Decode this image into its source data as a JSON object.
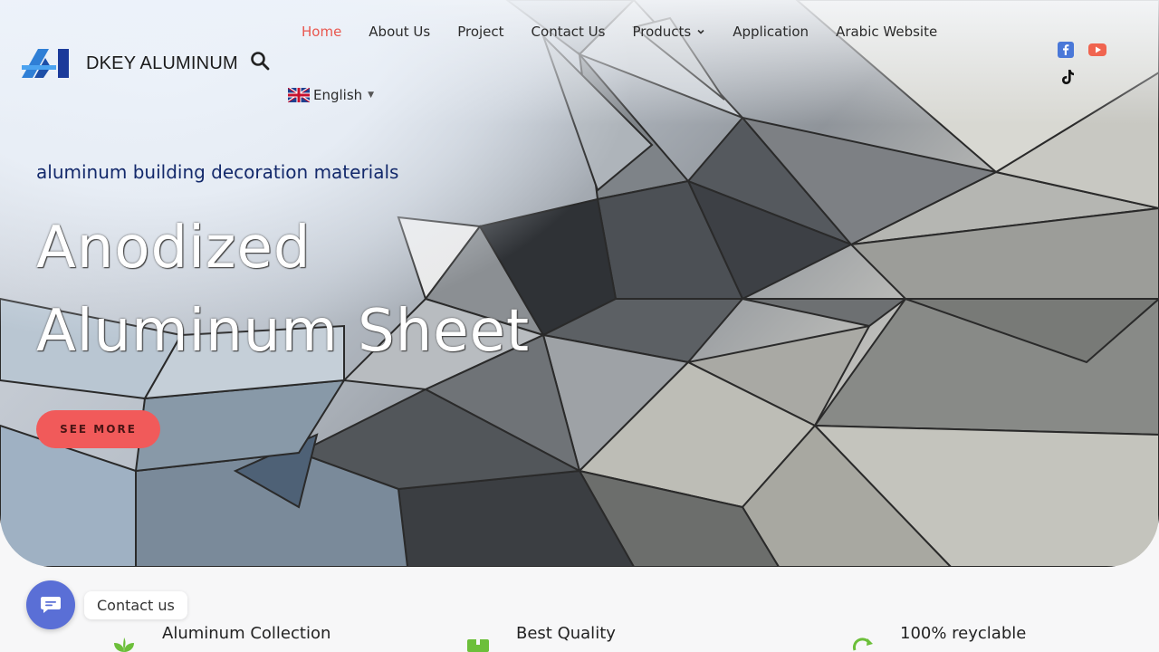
{
  "brand": {
    "name": "DKEY ALUMINUM"
  },
  "nav": {
    "items": [
      "Home",
      "About Us",
      "Project",
      "Contact Us",
      "Products",
      "Application",
      "Arabic Website"
    ],
    "active": "Home"
  },
  "language": {
    "selected": "English"
  },
  "hero": {
    "eyebrow": "aluminum building decoration materials",
    "headline_line1": "Anodized",
    "headline_line2": "Aluminum Sheet",
    "cta": "SEE MORE"
  },
  "contact_widget": {
    "label": "Contact us"
  },
  "features": [
    "Aluminum Collection",
    "Best Quality",
    "100% reyclable"
  ],
  "colors": {
    "accent": "#e9574f",
    "cta": "#f15a5a",
    "eyebrow": "#13296b",
    "chat": "#5a6fd6",
    "facebook": "#4a78d8",
    "youtube": "#f0644f",
    "feature_icon": "#6cbf3a"
  },
  "icons": [
    "logo-mark",
    "search-icon",
    "chevron-down-icon",
    "uk-flag-icon",
    "facebook-icon",
    "youtube-icon",
    "tiktok-icon",
    "chat-icon",
    "leaf-icon",
    "box-icon",
    "recycle-icon"
  ]
}
